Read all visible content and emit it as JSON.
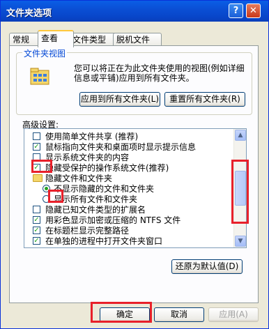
{
  "window": {
    "title": "文件夹选项",
    "help_glyph": "?",
    "close_glyph": "✕"
  },
  "tabs": [
    {
      "label": "常规",
      "active": false
    },
    {
      "label": "查看",
      "active": true
    },
    {
      "label": "文件类型",
      "active": false
    },
    {
      "label": "脱机文件",
      "active": false
    }
  ],
  "folder_views": {
    "legend": "文件夹视图",
    "description": "您可以将正在为此文件夹使用的视图(例如详细信息或平铺)应用到所有文件夹。",
    "apply_all_label": "应用到所有文件夹(L)",
    "reset_all_label": "重置所有文件夹(R)"
  },
  "advanced": {
    "label": "高级设置:",
    "items": [
      {
        "type": "checkbox",
        "checked": false,
        "text": "使用简单文件共享 (推荐)"
      },
      {
        "type": "checkbox",
        "checked": true,
        "text": "鼠标指向文件夹和桌面项时显示提示信息"
      },
      {
        "type": "checkbox",
        "checked": false,
        "text": "显示系统文件夹的内容"
      },
      {
        "type": "checkbox",
        "checked": true,
        "text": "隐藏受保护的操作系统文件(推荐)"
      },
      {
        "type": "folder",
        "text": "隐藏文件和文件夹"
      },
      {
        "type": "radio",
        "checked": true,
        "text": "不显示隐藏的文件和文件夹"
      },
      {
        "type": "radio",
        "checked": false,
        "text": "显示所有文件和文件夹"
      },
      {
        "type": "checkbox",
        "checked": false,
        "text": "隐藏已知文件类型的扩展名"
      },
      {
        "type": "checkbox",
        "checked": true,
        "text": "用彩色显示加密或压缩的 NTFS 文件"
      },
      {
        "type": "checkbox",
        "checked": true,
        "text": "在标题栏显示完整路径"
      },
      {
        "type": "checkbox",
        "checked": true,
        "text": "在单独的进程中打开文件夹窗口"
      }
    ],
    "scroll_up_glyph": "▲",
    "scroll_down_glyph": "▼",
    "restore_defaults_label": "还原为默认值(D)"
  },
  "footer": {
    "ok_label": "确定",
    "cancel_label": "取消",
    "apply_label": "应用(A)"
  },
  "colors": {
    "annotation": "#e8202a",
    "titlebar": "#0a4fd5",
    "check": "#21a121"
  }
}
